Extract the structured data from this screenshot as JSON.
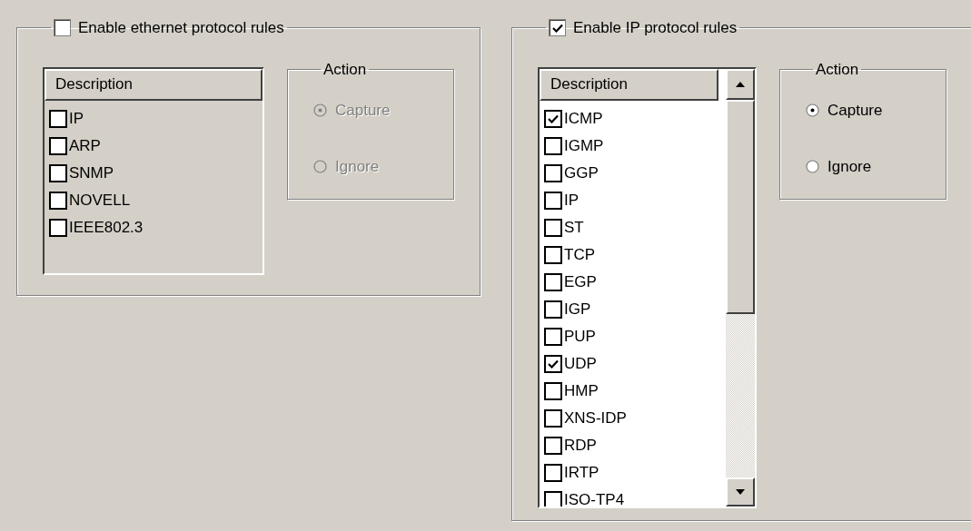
{
  "ethernet_rules": {
    "label": "Enable ethernet protocol rules",
    "checked": false,
    "list": {
      "column": "Description",
      "items": [
        {
          "label": "IP",
          "checked": false
        },
        {
          "label": "ARP",
          "checked": false
        },
        {
          "label": "SNMP",
          "checked": false
        },
        {
          "label": "NOVELL",
          "checked": false
        },
        {
          "label": "IEEE802.3",
          "checked": false
        }
      ]
    },
    "action": {
      "title": "Action",
      "options": [
        {
          "label": "Capture",
          "selected": true
        },
        {
          "label": "Ignore",
          "selected": false
        }
      ]
    }
  },
  "ip_rules": {
    "label": "Enable IP protocol rules",
    "checked": true,
    "list": {
      "column": "Description",
      "items": [
        {
          "label": "ICMP",
          "checked": true
        },
        {
          "label": "IGMP",
          "checked": false
        },
        {
          "label": "GGP",
          "checked": false
        },
        {
          "label": "IP",
          "checked": false
        },
        {
          "label": "ST",
          "checked": false
        },
        {
          "label": "TCP",
          "checked": false
        },
        {
          "label": "EGP",
          "checked": false
        },
        {
          "label": "IGP",
          "checked": false
        },
        {
          "label": "PUP",
          "checked": false
        },
        {
          "label": "UDP",
          "checked": true
        },
        {
          "label": "HMP",
          "checked": false
        },
        {
          "label": "XNS-IDP",
          "checked": false
        },
        {
          "label": "RDP",
          "checked": false
        },
        {
          "label": "IRTP",
          "checked": false
        },
        {
          "label": "ISO-TP4",
          "checked": false
        }
      ]
    },
    "action": {
      "title": "Action",
      "options": [
        {
          "label": "Capture",
          "selected": true
        },
        {
          "label": "Ignore",
          "selected": false
        }
      ]
    }
  }
}
